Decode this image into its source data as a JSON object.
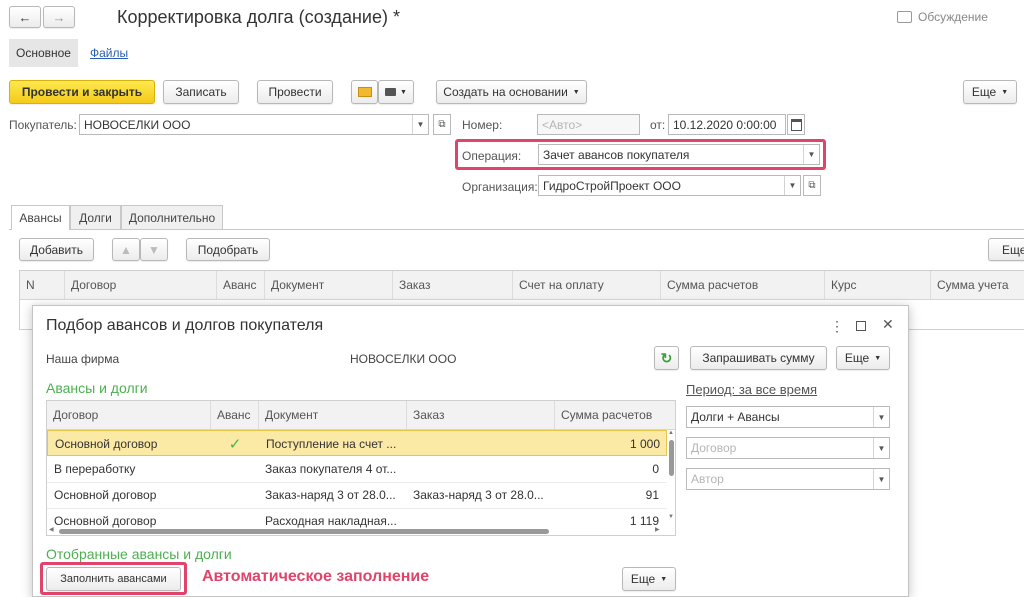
{
  "window": {
    "title": "Корректировка долга (создание) *",
    "discussion_label": "Обсуждение"
  },
  "nav_tabs": [
    "Основное",
    "Файлы"
  ],
  "toolbar": {
    "post_close": "Провести и закрыть",
    "save": "Записать",
    "post": "Провести",
    "create_based": "Создать на основании",
    "more": "Еще"
  },
  "form": {
    "buyer_label": "Покупатель:",
    "buyer_value": "НОВОСЕЛКИ ООО",
    "number_label": "Номер:",
    "number_placeholder": "<Авто>",
    "date_label": "от:",
    "date_value": "10.12.2020  0:00:00",
    "operation_label": "Операция:",
    "operation_value": "Зачет авансов покупателя",
    "org_label": "Организация:",
    "org_value": "ГидроСтройПроект ООО"
  },
  "doc_tabs": [
    "Авансы",
    "Долги",
    "Дополнительно"
  ],
  "table_toolbar": {
    "add": "Добавить",
    "pick": "Подобрать",
    "more": "Еще"
  },
  "main_table": {
    "columns": [
      "N",
      "Договор",
      "Аванс",
      "Документ",
      "Заказ",
      "Счет на оплату",
      "Сумма расчетов",
      "Курс",
      "Сумма учета"
    ]
  },
  "dialog": {
    "title": "Подбор авансов и долгов покупателя",
    "our_firm_label": "Наша фирма",
    "our_firm_value": "НОВОСЕЛКИ ООО",
    "request_sum": "Запрашивать сумму",
    "more": "Еще",
    "section_title": "Авансы и долги",
    "period_link": "Период: за все время",
    "filter_type": "Долги + Авансы",
    "filter_contract_placeholder": "Договор",
    "filter_author_placeholder": "Автор",
    "columns": [
      "Договор",
      "Аванс",
      "Документ",
      "Заказ",
      "Сумма расчетов"
    ],
    "rows": [
      {
        "contract": "Основной договор",
        "advance": "✓",
        "document": "Поступление на счет ...",
        "order": "",
        "sum": "1 000"
      },
      {
        "contract": "В переработку",
        "advance": "",
        "document": "Заказ покупателя 4 от...",
        "order": "",
        "sum": "0"
      },
      {
        "contract": "Основной договор",
        "advance": "",
        "document": "Заказ-наряд 3 от 28.0...",
        "order": "Заказ-наряд 3 от 28.0...",
        "sum": "91"
      },
      {
        "contract": "Основной договор",
        "advance": "",
        "document": "Расходная накладная...",
        "order": "",
        "sum": "1 119"
      }
    ],
    "selected_title": "Отобранные авансы и долги",
    "fill_advances": "Заполнить авансами",
    "more2": "Еще"
  },
  "annotation": "Автоматическое заполнение",
  "colors": {
    "accent_pink": "#e0446b",
    "green": "#4caf50",
    "yellow": "#f4c91a",
    "selected_row": "#fbe9a6"
  }
}
